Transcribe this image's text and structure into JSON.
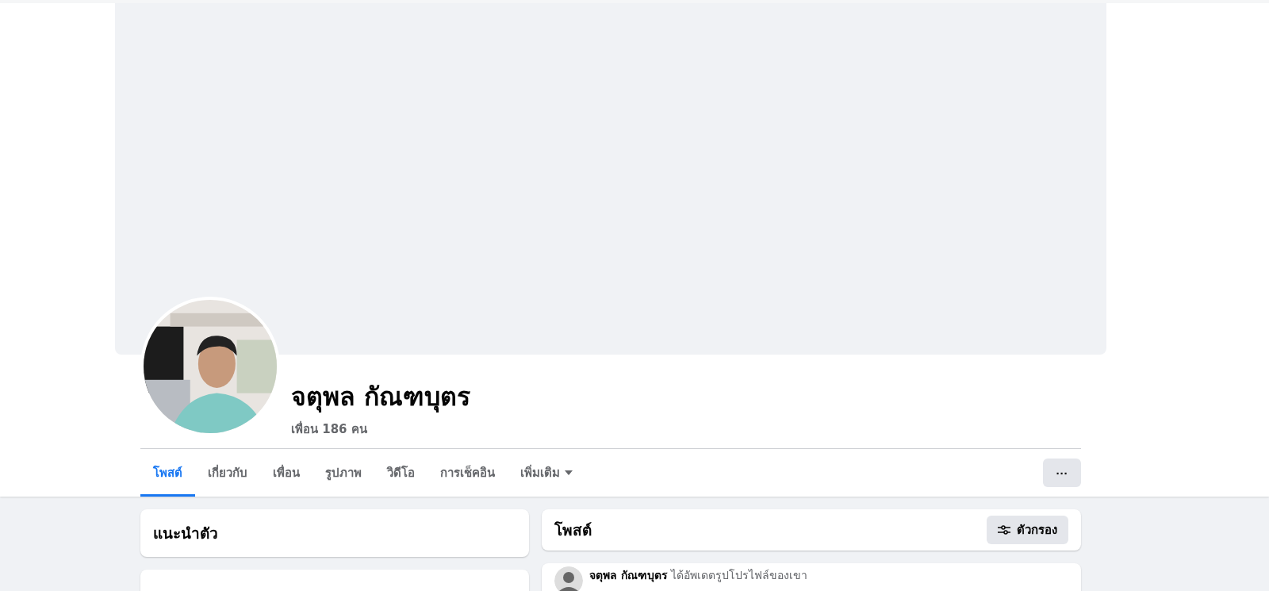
{
  "profile": {
    "name": "จตุพล กัณฑบุตร",
    "friends": "เพื่อน 186 คน"
  },
  "tabs": [
    {
      "label": "โพสต์",
      "selected": true
    },
    {
      "label": "เกี่ยวกับ",
      "selected": false
    },
    {
      "label": "เพื่อน",
      "selected": false
    },
    {
      "label": "รูปภาพ",
      "selected": false
    },
    {
      "label": "วิดีโอ",
      "selected": false
    },
    {
      "label": "การเช็คอิน",
      "selected": false
    },
    {
      "label": "เพิ่มเติม",
      "selected": false,
      "dropdown": true
    }
  ],
  "more_button": "···",
  "intro": {
    "title": "แนะนำตัว"
  },
  "posts": {
    "title": "โพสต์",
    "filter_button": "ตัวกรอง"
  },
  "post": {
    "author": "จตุพล กัณฑบุตร",
    "action": "ได้อัพเดตรูปโปรไฟล์ของเขา"
  }
}
